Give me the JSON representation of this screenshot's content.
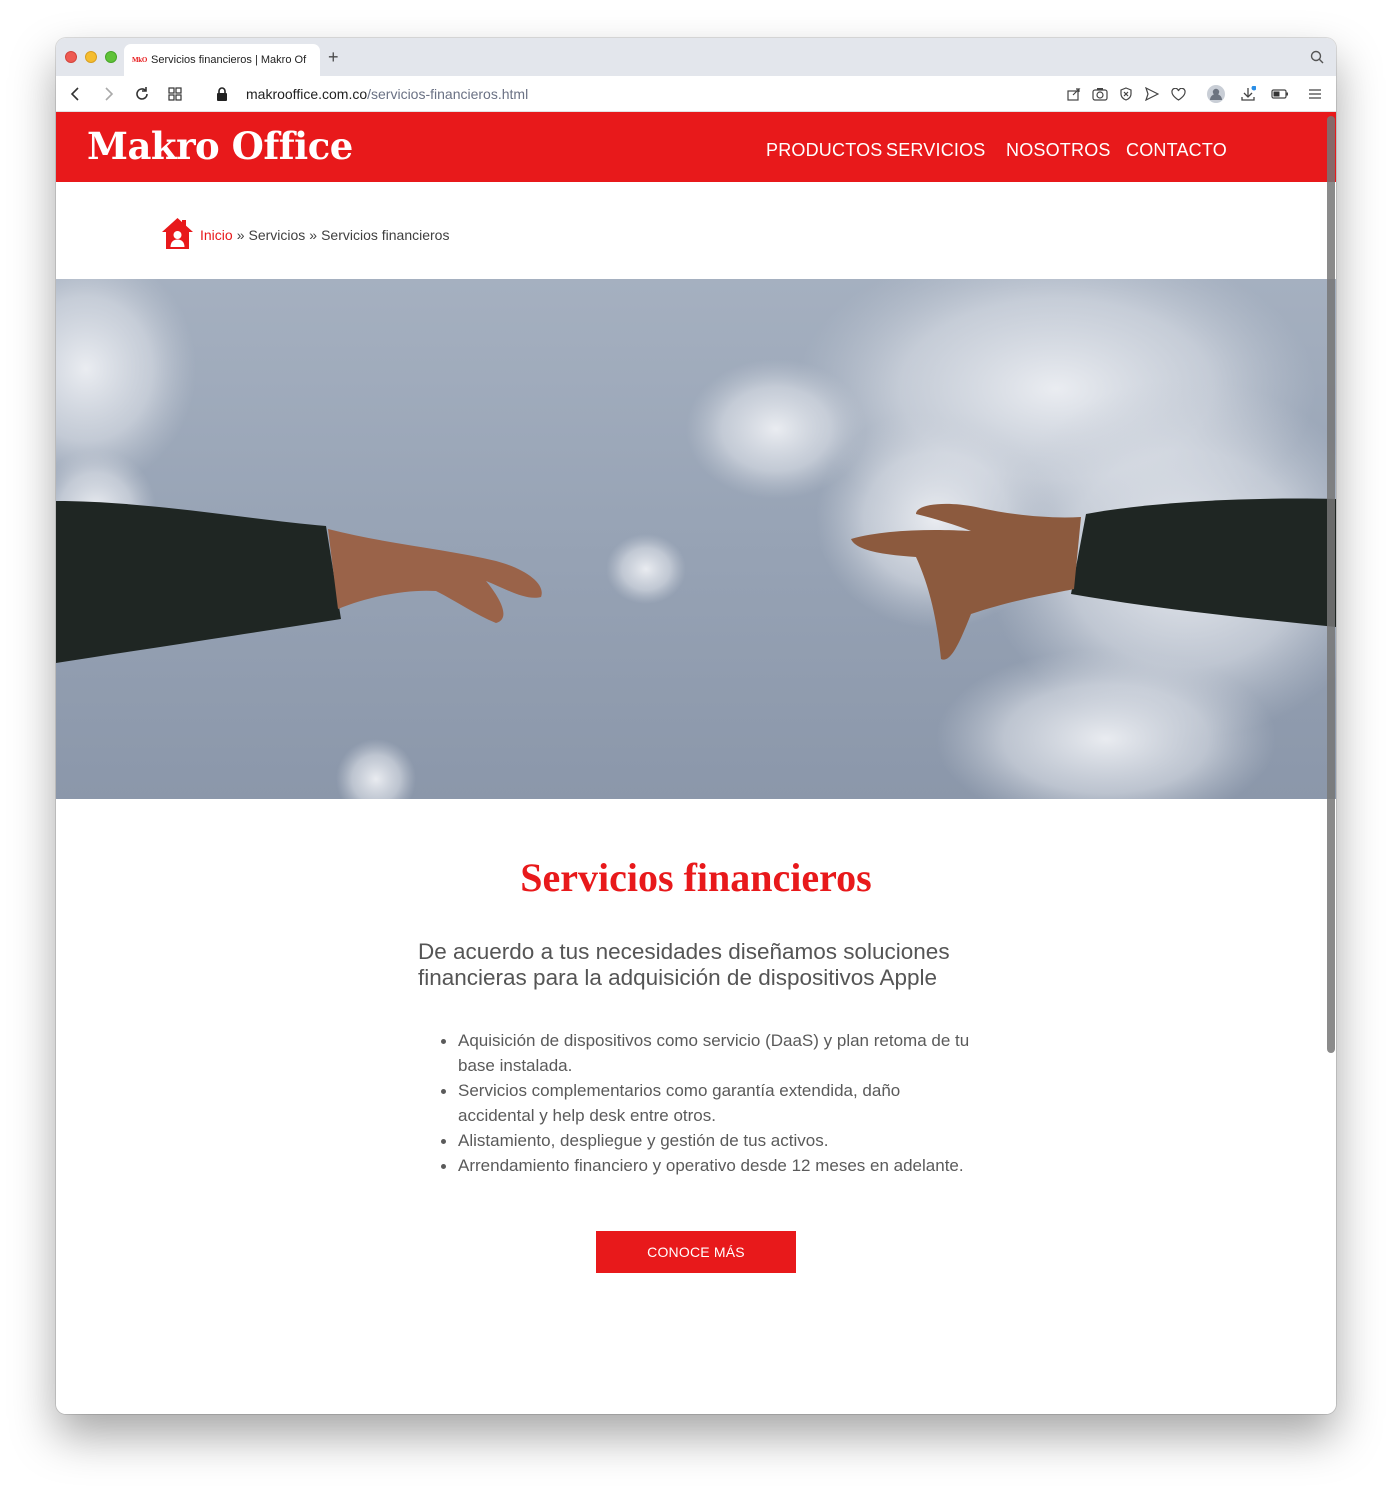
{
  "browser": {
    "tab_title": "Servicios financieros | Makro Of",
    "tab_favicon": "MkO",
    "new_tab": "+",
    "url_domain": "makrooffice.com.co",
    "url_path": "/servicios-financieros.html"
  },
  "header": {
    "logo": "Makro Office",
    "nav": {
      "productos": "PRODUCTOS",
      "servicios": "SERVICIOS",
      "nosotros": "NOSOTROS",
      "contacto": "CONTACTO"
    },
    "brand_color": "#e8191b"
  },
  "breadcrumb": {
    "home": "Inicio",
    "sep": "»",
    "services": "Servicios",
    "current": "Servicios financieros"
  },
  "main": {
    "title": "Servicios financieros",
    "intro": "De acuerdo a tus necesidades diseñamos soluciones financieras para la adquisición de dispositivos Apple",
    "bullets": [
      "Aquisición de dispositivos como servicio (DaaS) y plan retoma de tu base instalada.",
      "Servicios complementarios como garantía extendida, daño accidental y help desk entre otros.",
      "Alistamiento, despliegue y gestión de tus activos.",
      "Arrendamiento financiero y operativo desde 12 meses en adelante."
    ],
    "cta": "CONOCE MÁS"
  }
}
